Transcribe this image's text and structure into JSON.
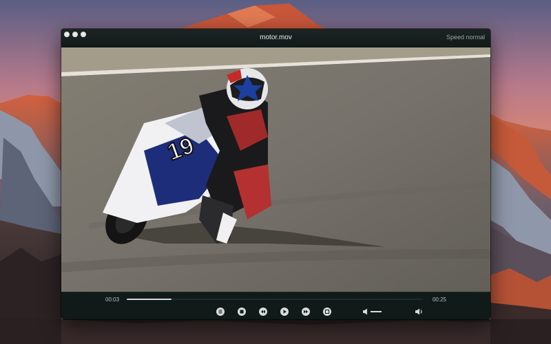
{
  "window": {
    "title": "motor.mov",
    "speed_label": "Speed normal"
  },
  "player": {
    "current_time": "00:03",
    "total_time": "00:25",
    "progress_fraction": 0.15,
    "volume_fraction": 1.0
  },
  "controls": [
    {
      "name": "playlist-button",
      "icon": "playlist-icon"
    },
    {
      "name": "stop-button",
      "icon": "stop-icon"
    },
    {
      "name": "rewind-button",
      "icon": "rewind-icon"
    },
    {
      "name": "play-button",
      "icon": "play-icon"
    },
    {
      "name": "fast-forward-button",
      "icon": "fast-forward-icon"
    },
    {
      "name": "fullscreen-button",
      "icon": "fullscreen-icon"
    }
  ],
  "colors": {
    "window_bg": "#0f1716",
    "control_fg": "#d8dcda",
    "accent_progress": "#d7dbd9"
  }
}
